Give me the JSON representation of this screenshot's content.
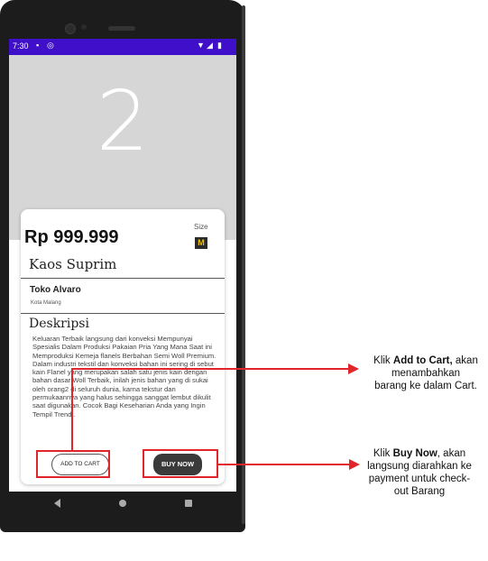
{
  "status_bar": {
    "time": "7:30",
    "left_icons": [
      "notification-icon",
      "sync-icon"
    ],
    "right_icons": [
      "wifi-icon",
      "signal-icon",
      "battery-icon"
    ]
  },
  "hero": {
    "number": "2"
  },
  "product": {
    "price": "Rp 999.999",
    "size_label": "Size",
    "size_value": "M",
    "title": "Kaos Suprim",
    "store_name": "Toko Alvaro",
    "store_city": "Kota Malang",
    "description_title": "Deskripsi",
    "description": "Keluaran Terbaik langsung dari konveksi Mempunyai Spesialis Dalam Produksi Pakaian Pria Yang Mana Saat ini Memproduksi Kemeja flanels Berbahan Semi Woll Premium. Dalam industri tekstil dan konveksi bahan ini sering di sebut kain Flanel yang merupakan salah satu jenis kain dengan bahan dasar Woll Terbaik, inilah jenis bahan yang di sukai oleh orang2 di seluruh dunia, karna tekstur dan permukaannya yang halus sehingga sanggat lembut dikulit saat digunakan. Cocok Bagi Keseharian Anda yang Ingin Tempil Trendi."
  },
  "buttons": {
    "add_to_cart": "ADD TO CART",
    "buy_now": "BUY NOW"
  },
  "annotations": {
    "cart_prefix": "Klik ",
    "cart_bold": "Add to Cart,",
    "cart_line1_rest": " akan",
    "cart_line2": "menambahkan",
    "cart_line3": "barang ke dalam Cart.",
    "buy_prefix": "Klik ",
    "buy_bold": "Buy Now",
    "buy_line1_rest": ", akan",
    "buy_line2": "langsung diarahkan ke",
    "buy_line3": "payment untuk check-",
    "buy_line4": "out Barang"
  },
  "colors": {
    "status_bar": "#3f0fc9",
    "hero_bg": "#d6d6d6",
    "highlight": "#e0262b",
    "size_badge_text": "#f3c20b"
  }
}
